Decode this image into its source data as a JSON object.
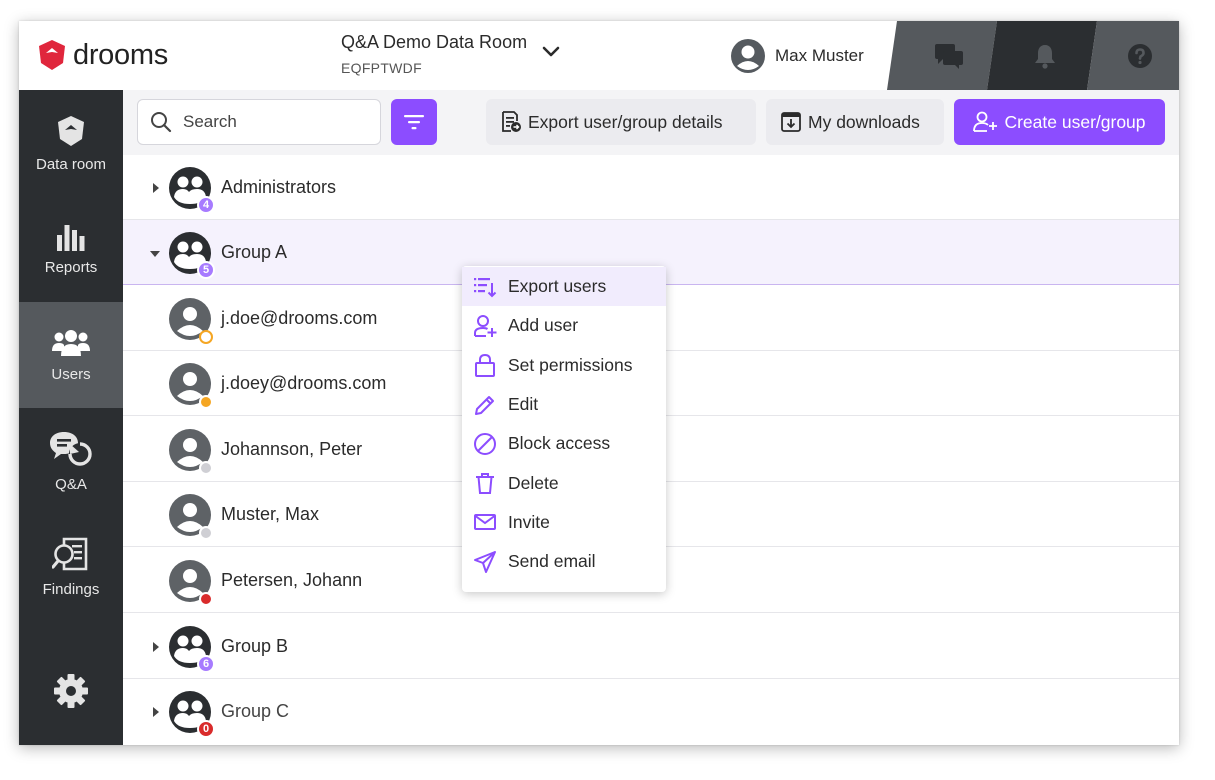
{
  "app": {
    "logo_text": "drooms"
  },
  "header": {
    "room_title": "Q&A Demo Data Room",
    "room_code": "EQFPTWDF",
    "user_name": "Max Muster"
  },
  "sidebar": {
    "items": [
      {
        "label": "Data room",
        "icon": "shield-icon"
      },
      {
        "label": "Reports",
        "icon": "bar-chart-icon"
      },
      {
        "label": "Users",
        "icon": "users-icon"
      },
      {
        "label": "Q&A",
        "icon": "qa-icon"
      },
      {
        "label": "Findings",
        "icon": "findings-icon"
      }
    ],
    "settings_icon": "gear-icon"
  },
  "toolbar": {
    "search_placeholder": "Search",
    "export_label": "Export user/group details",
    "downloads_label": "My downloads",
    "create_label": "Create user/group"
  },
  "list": {
    "rows": [
      {
        "type": "group",
        "label": "Administrators",
        "count": "4",
        "expanded": false
      },
      {
        "type": "group",
        "label": "Group A",
        "count": "5",
        "expanded": true
      },
      {
        "type": "user",
        "label": "j.doe@drooms.com",
        "status": "pending"
      },
      {
        "type": "user",
        "label": "j.doey@drooms.com",
        "status": "invited"
      },
      {
        "type": "user",
        "label": "Johannson, Peter",
        "status": "inactive"
      },
      {
        "type": "user",
        "label": "Muster, Max",
        "status": "inactive"
      },
      {
        "type": "user",
        "label": "Petersen, Johann",
        "status": "blocked"
      },
      {
        "type": "group",
        "label": "Group B",
        "count": "6",
        "expanded": false
      },
      {
        "type": "group",
        "label": "Group C",
        "count": "0",
        "expanded": false
      }
    ]
  },
  "context_menu": {
    "items": [
      {
        "label": "Export users",
        "icon": "export-list-icon"
      },
      {
        "label": "Add user",
        "icon": "add-user-icon"
      },
      {
        "label": "Set permissions",
        "icon": "lock-icon"
      },
      {
        "label": "Edit",
        "icon": "pencil-icon"
      },
      {
        "label": "Block access",
        "icon": "block-icon"
      },
      {
        "label": "Delete",
        "icon": "trash-icon"
      },
      {
        "label": "Invite",
        "icon": "envelope-icon"
      },
      {
        "label": "Send email",
        "icon": "send-icon"
      }
    ]
  },
  "colors": {
    "accent": "#8c4dff",
    "brand_red": "#e0263c",
    "sidebar_bg": "#2b2e31",
    "status_pending": "#f5a623",
    "status_invited": "#f5a623",
    "status_inactive": "#cfcfd4",
    "status_blocked": "#d92b2b"
  }
}
